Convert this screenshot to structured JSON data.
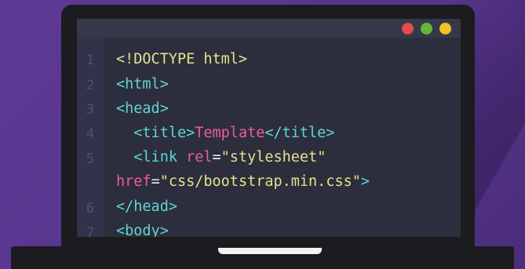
{
  "window": {
    "controls": [
      {
        "name": "close",
        "color": "#e44a4d"
      },
      {
        "name": "maximize",
        "color": "#63b53d"
      },
      {
        "name": "minimize",
        "color": "#f2c027"
      }
    ]
  },
  "editor": {
    "line_numbers": [
      "1",
      "2",
      "3",
      "4",
      "5",
      "6",
      "7"
    ],
    "lines": [
      {
        "parts": [
          {
            "text": "<!DOCTYPE html>",
            "color": "yellow"
          }
        ]
      },
      {
        "parts": [
          {
            "text": "<html>",
            "color": "cyan"
          }
        ]
      },
      {
        "parts": [
          {
            "text": "<head>",
            "color": "cyan"
          }
        ]
      },
      {
        "parts": [
          {
            "text": "  <title>",
            "color": "cyan"
          },
          {
            "text": "Template",
            "color": "pink"
          },
          {
            "text": "</title>",
            "color": "cyan"
          }
        ]
      },
      {
        "parts": [
          {
            "text": "  <link ",
            "color": "cyan"
          },
          {
            "text": "rel",
            "color": "pink"
          },
          {
            "text": "=",
            "color": "white"
          },
          {
            "text": "\"stylesheet\"",
            "color": "yellow"
          }
        ]
      },
      {
        "parts": [
          {
            "text": "href",
            "color": "pink"
          },
          {
            "text": "=",
            "color": "white"
          },
          {
            "text": "\"css/bootstrap.min.css\"",
            "color": "yellow"
          },
          {
            "text": ">",
            "color": "cyan"
          }
        ]
      },
      {
        "parts": [
          {
            "text": "</head>",
            "color": "cyan"
          }
        ]
      },
      {
        "parts": [
          {
            "text": "<body>",
            "color": "cyan"
          }
        ]
      }
    ]
  },
  "colors": {
    "background": "#5b3892",
    "laptop": "#1c1b1f",
    "editor_bg": "#2c2e3d",
    "yellow": "#e3e38a",
    "cyan": "#5fd6cf",
    "pink": "#ee5aa0"
  }
}
